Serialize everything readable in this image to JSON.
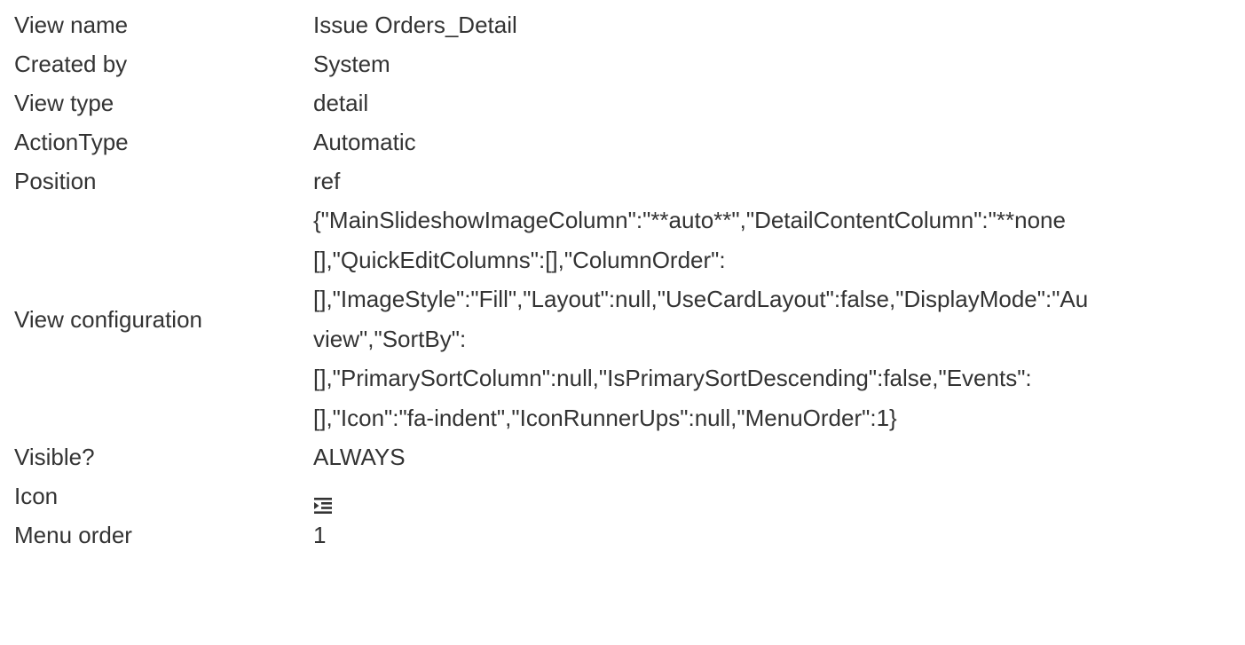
{
  "rows": [
    {
      "label": "View name",
      "value": "Issue Orders_Detail"
    },
    {
      "label": "Created by",
      "value": "System"
    },
    {
      "label": "View type",
      "value": "detail"
    },
    {
      "label": "ActionType",
      "value": "Automatic"
    },
    {
      "label": "Position",
      "value": "ref"
    }
  ],
  "view_configuration": {
    "label": "View configuration",
    "lines": [
      "{\"MainSlideshowImageColumn\":\"**auto**\",\"DetailContentColumn\":\"**none",
      "[],\"QuickEditColumns\":[],\"ColumnOrder\":",
      "[],\"ImageStyle\":\"Fill\",\"Layout\":null,\"UseCardLayout\":false,\"DisplayMode\":\"Au",
      "view\",\"SortBy\":",
      "[],\"PrimarySortColumn\":null,\"IsPrimarySortDescending\":false,\"Events\":",
      "[],\"Icon\":\"fa-indent\",\"IconRunnerUps\":null,\"MenuOrder\":1}"
    ]
  },
  "visible": {
    "label": "Visible?",
    "value": "ALWAYS"
  },
  "icon": {
    "label": "Icon",
    "icon_name": "indent-icon"
  },
  "menu_order": {
    "label": "Menu order",
    "value": "1"
  }
}
